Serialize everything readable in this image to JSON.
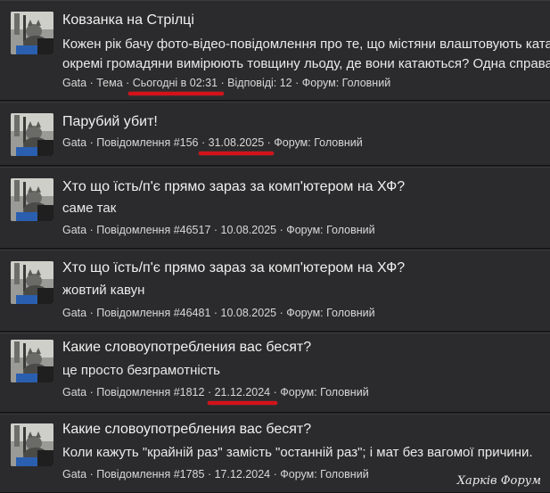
{
  "results": [
    {
      "title": "Ковзанка на Стрілці",
      "snippet_lines": [
        "Кожен рік бачу фото-відео-повідомлення про те, що містяни влаштовують ката",
        "окремі громадяни вимірюють товщину льоду, де вони катаються? Одна справа"
      ],
      "meta": [
        "Gata",
        "Тема",
        "Сьогодні в 02:31",
        "Відповіді: 12",
        "Форум: Головний"
      ]
    },
    {
      "title": "Парубий убит!",
      "snippet_lines": [],
      "meta": [
        "Gata",
        "Повідомлення #156",
        "31.08.2025",
        "Форум: Головний"
      ]
    },
    {
      "title": "Хто що їсть/п'є прямо зараз за комп'ютером на ХФ?",
      "snippet_lines": [
        "саме так"
      ],
      "meta": [
        "Gata",
        "Повідомлення #46517",
        "10.08.2025",
        "Форум: Головний"
      ]
    },
    {
      "title": "Хто що їсть/п'є прямо зараз за комп'ютером на ХФ?",
      "snippet_lines": [
        "жовтий кавун"
      ],
      "meta": [
        "Gata",
        "Повідомлення #46481",
        "10.08.2025",
        "Форум: Головний"
      ]
    },
    {
      "title": "Какие словоупотребления вас бесят?",
      "snippet_lines": [
        "це просто безграмотність"
      ],
      "meta": [
        "Gata",
        "Повідомлення #1812",
        "21.12.2024",
        "Форум: Головний"
      ]
    },
    {
      "title": "Какие словоупотребления вас бесят?",
      "snippet_lines": [
        "Коли кажуть \"крайній раз\" замість \"останній раз\"; і мат без вагомої причини."
      ],
      "meta": [
        "Gata",
        "Повідомлення #1785",
        "17.12.2024",
        "Форум: Головний"
      ]
    }
  ],
  "meta_separator": " · ",
  "watermark": "Харків Форум",
  "colors": {
    "highlight_underline": "#d3121a",
    "background": "#1d1d1f",
    "card": "#2b2b2d"
  }
}
